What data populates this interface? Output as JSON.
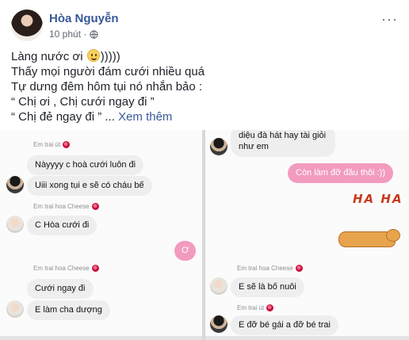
{
  "post": {
    "author": "Hòa Nguyễn",
    "time": "10 phút ·",
    "more_label": "···",
    "lines": {
      "l1_before": "Làng nước ơi ",
      "l1_after": ")))))",
      "l2": "Thấy mọi người đám cưới nhiều quá",
      "l3": "Tự dưng đêm hôm tụi nó nhắn bảo :",
      "l4": "“ Chị ơi , Chị cưới ngay đi ”",
      "l5": "“ Chị đẻ ngay đi ” ... ",
      "see_more": "Xem thêm"
    }
  },
  "chat_left": {
    "sender1": "Em trai út",
    "msg1": "Nàyyyy c hoà cưới luôn đi",
    "msg2": "Uiii xong tụi e sẽ có cháu bế",
    "sender2": "Em trai hoa Cheese",
    "msg3": "C Hòa cưới đi",
    "reply1": "Ơ",
    "sender3": "Em trai hoa Cheese",
    "msg4": "Cưới ngay đi",
    "msg5": "E làm cha dượng"
  },
  "chat_right": {
    "msg_top": "diệu đà hát hay tài giỏi như em",
    "reply1": "Còn làm đỡ đầu thôi :))",
    "sticker_text": "HA HA",
    "sender1": "Em trai hoa Cheese",
    "msg1": "E sẽ là bố nuôi",
    "sender2": "Em trai út",
    "msg2": "E đỡ bé gái a đỡ bé trai"
  }
}
